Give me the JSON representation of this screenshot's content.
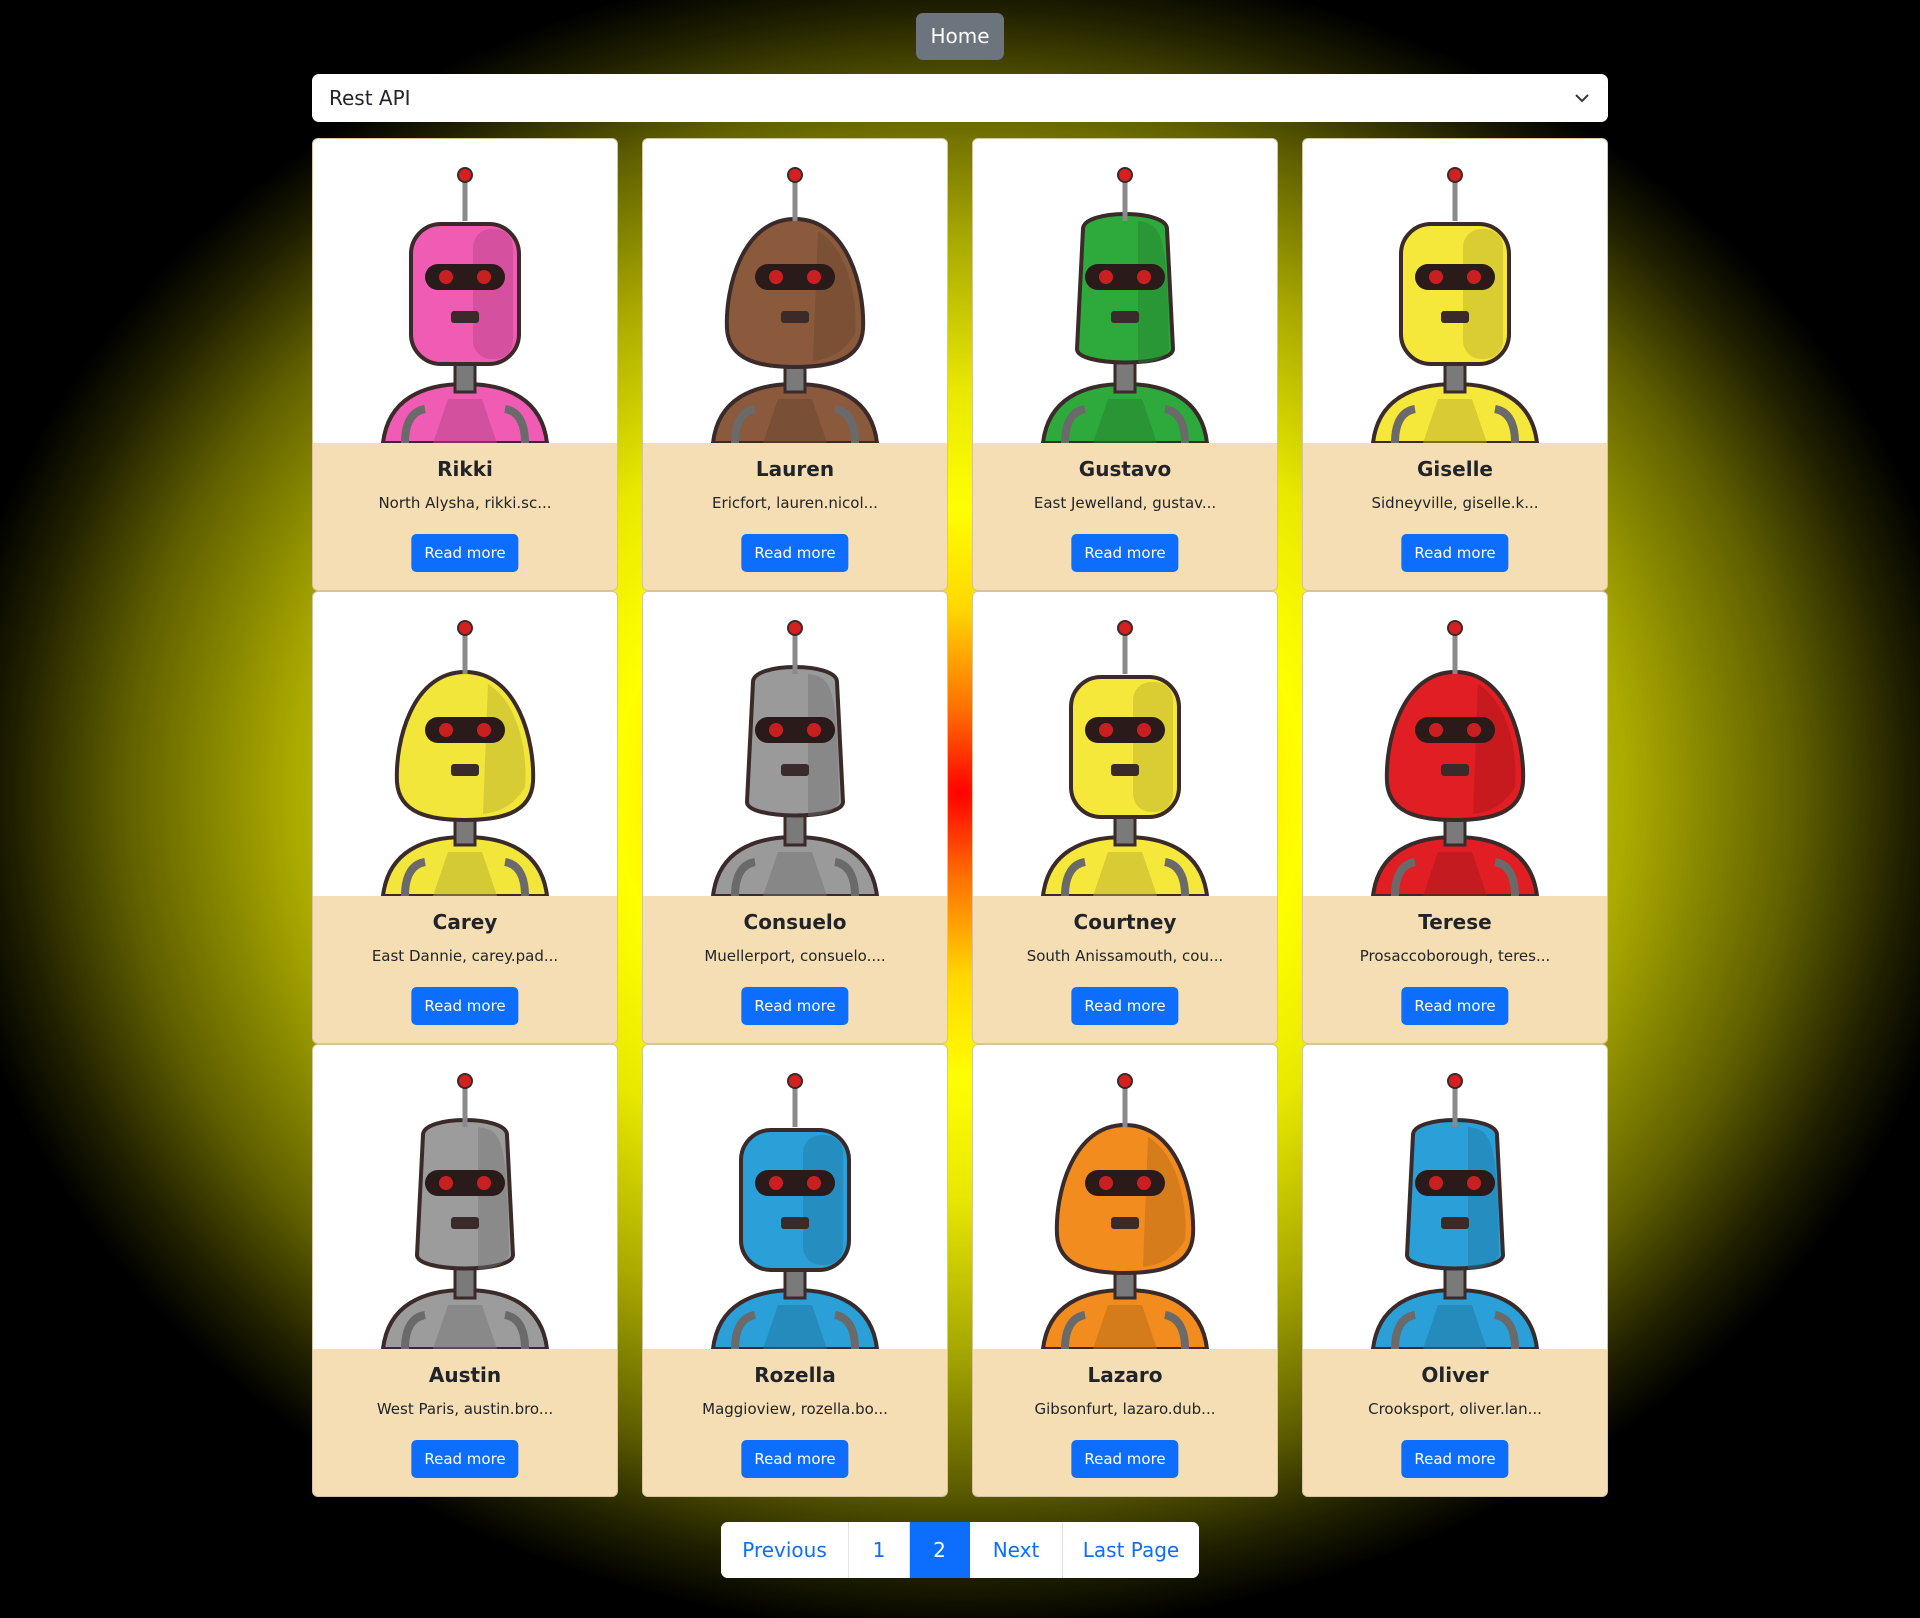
{
  "nav": {
    "home_label": "Home"
  },
  "source_select": {
    "selected": "Rest API"
  },
  "robots": [
    {
      "name": "Rikki",
      "desc": "North Alysha, rikki.sc...",
      "button": "Read more",
      "color": "#f05cb4"
    },
    {
      "name": "Lauren",
      "desc": "Ericfort, lauren.nicol...",
      "button": "Read more",
      "color": "#8b5a3c"
    },
    {
      "name": "Gustavo",
      "desc": "East Jewelland, gustav...",
      "button": "Read more",
      "color": "#2eaa3c"
    },
    {
      "name": "Giselle",
      "desc": "Sidneyville, giselle.k...",
      "button": "Read more",
      "color": "#f6e83a"
    },
    {
      "name": "Carey",
      "desc": "East Dannie, carey.pad...",
      "button": "Read more",
      "color": "#f2e63a"
    },
    {
      "name": "Consuelo",
      "desc": "Muellerport, consuelo....",
      "button": "Read more",
      "color": "#9a9a9a"
    },
    {
      "name": "Courtney",
      "desc": "South Anissamouth, cou...",
      "button": "Read more",
      "color": "#f6e83a"
    },
    {
      "name": "Terese",
      "desc": "Prosaccoborough, teres...",
      "button": "Read more",
      "color": "#e01e24"
    },
    {
      "name": "Austin",
      "desc": "West Paris, austin.bro...",
      "button": "Read more",
      "color": "#9c9c9c"
    },
    {
      "name": "Rozella",
      "desc": "Maggioview, rozella.bo...",
      "button": "Read more",
      "color": "#2a9fd8"
    },
    {
      "name": "Lazaro",
      "desc": "Gibsonfurt, lazaro.dub...",
      "button": "Read more",
      "color": "#f28c1e"
    },
    {
      "name": "Oliver",
      "desc": "Crooksport, oliver.lan...",
      "button": "Read more",
      "color": "#2a9fd8"
    }
  ],
  "pagination": {
    "previous": "Previous",
    "page1": "1",
    "page2": "2",
    "next": "Next",
    "last": "Last Page",
    "active_page": "2"
  },
  "colors": {
    "button_primary": "#0d6efd",
    "home_button": "#6c757d",
    "card_body": "#f5deb3"
  }
}
